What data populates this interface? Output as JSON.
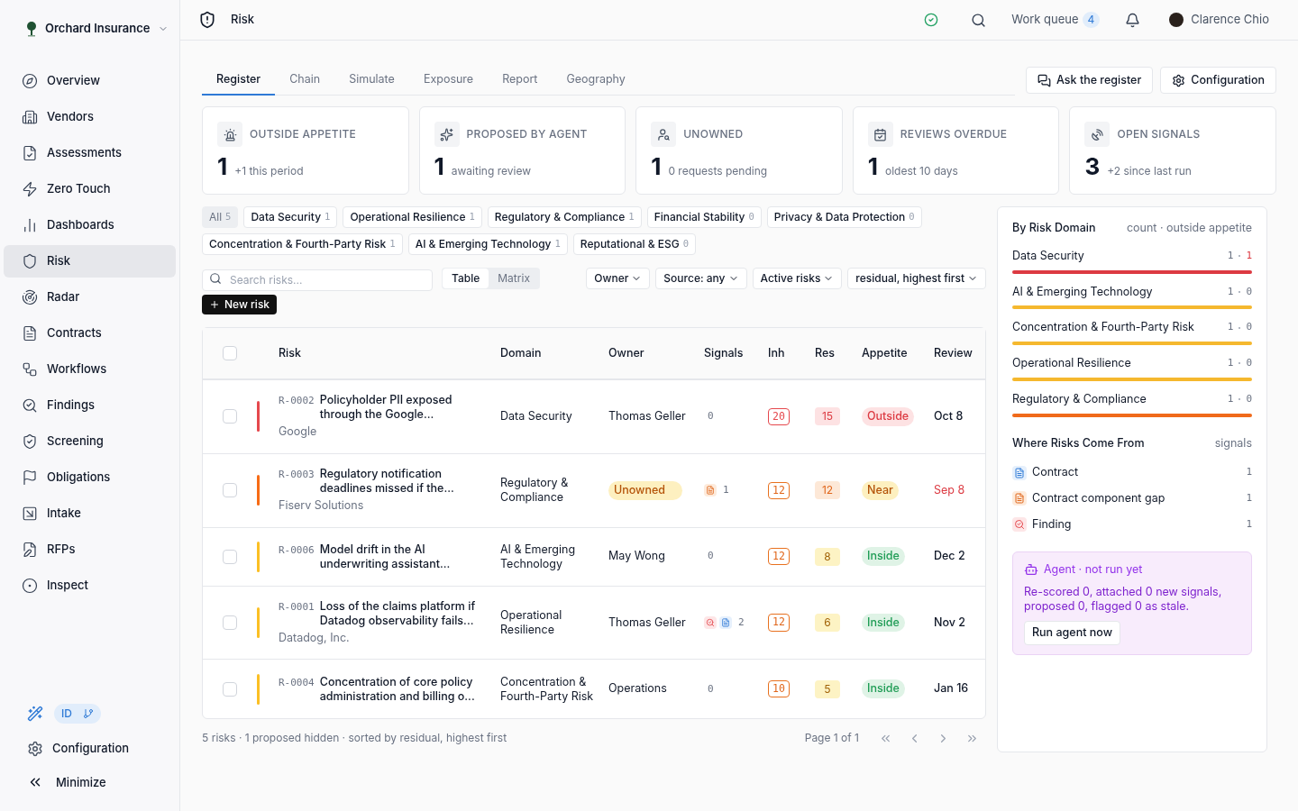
{
  "org": {
    "name": "Orchard Insurance"
  },
  "nav": [
    {
      "label": "Overview",
      "selected": false
    },
    {
      "label": "Vendors",
      "selected": false
    },
    {
      "label": "Assessments",
      "selected": false
    },
    {
      "label": "Zero Touch",
      "selected": false
    },
    {
      "label": "Dashboards",
      "selected": false
    },
    {
      "label": "Risk",
      "selected": true
    },
    {
      "label": "Radar",
      "selected": false
    },
    {
      "label": "Contracts",
      "selected": false
    },
    {
      "label": "Workflows",
      "selected": false
    },
    {
      "label": "Findings",
      "selected": false
    },
    {
      "label": "Screening",
      "selected": false
    },
    {
      "label": "Obligations",
      "selected": false
    },
    {
      "label": "Intake",
      "selected": false
    },
    {
      "label": "RFPs",
      "selected": false
    },
    {
      "label": "Inspect",
      "selected": false
    }
  ],
  "sidebar_footer": {
    "badge": "ID",
    "configuration": "Configuration",
    "minimize": "Minimize"
  },
  "header": {
    "title": "Risk",
    "work_queue": "Work queue",
    "work_queue_count": "4",
    "user": "Clarence Chio"
  },
  "tabs": [
    {
      "label": "Register",
      "selected": true
    },
    {
      "label": "Chain",
      "selected": false
    },
    {
      "label": "Simulate",
      "selected": false
    },
    {
      "label": "Exposure",
      "selected": false
    },
    {
      "label": "Report",
      "selected": false
    },
    {
      "label": "Geography",
      "selected": false
    }
  ],
  "actions": [
    "Ask the register",
    "Configuration"
  ],
  "stats": [
    {
      "title": "OUTSIDE APPETITE",
      "value": "1",
      "note": "+1 this period"
    },
    {
      "title": "PROPOSED BY AGENT",
      "value": "1",
      "note": "awaiting review"
    },
    {
      "title": "UNOWNED",
      "value": "1",
      "note": "0 requests pending"
    },
    {
      "title": "REVIEWS OVERDUE",
      "value": "1",
      "note": "oldest 10 days"
    },
    {
      "title": "OPEN SIGNALS",
      "value": "3",
      "note": "+2 since last run"
    }
  ],
  "domain_filters": [
    {
      "label": "All",
      "count": "5",
      "selected": true
    },
    {
      "label": "Data Security",
      "count": "1",
      "selected": false
    },
    {
      "label": "Operational Resilience",
      "count": "1",
      "selected": false
    },
    {
      "label": "Regulatory & Compliance",
      "count": "1",
      "selected": false
    },
    {
      "label": "Financial Stability",
      "count": "0",
      "selected": false
    },
    {
      "label": "Privacy & Data Protection",
      "count": "0",
      "selected": false
    },
    {
      "label": "Concentration & Fourth-Party Risk",
      "count": "1",
      "selected": false
    },
    {
      "label": "AI & Emerging Technology",
      "count": "1",
      "selected": false
    },
    {
      "label": "Reputational & ESG",
      "count": "0",
      "selected": false
    }
  ],
  "search": {
    "placeholder": "Search risks..."
  },
  "views": [
    {
      "label": "Table",
      "selected": true
    },
    {
      "label": "Matrix",
      "selected": false
    }
  ],
  "filters": [
    "Owner",
    "Source: any",
    "Active risks",
    "residual, highest first"
  ],
  "new_risk": "New risk",
  "table": {
    "all_checked": false,
    "columns": [
      "Risk",
      "Domain",
      "Owner",
      "Signals",
      "Inh",
      "Res",
      "Appetite",
      "Review"
    ],
    "rows": [
      {
        "checked": false,
        "color": "#e5484d",
        "id": "R-0002",
        "title": "Policyholder PII exposed through the Google...",
        "vendor": "Google",
        "domain": "Data Security",
        "owner": {
          "text": "Thomas Geller",
          "kind": "person"
        },
        "signals": [],
        "signal_count": "0",
        "inh": {
          "text": "20",
          "kind": "high"
        },
        "res": {
          "text": "15",
          "kind": "high"
        },
        "appetite": {
          "text": "Outside",
          "kind": "outside"
        },
        "review": "Oct 8",
        "review_overdue": false
      },
      {
        "checked": false,
        "color": "#f76b15",
        "id": "R-0003",
        "title": "Regulatory notification deadlines missed if the...",
        "vendor": "Fiserv Solutions",
        "domain": "Regulatory & Compliance",
        "owner": {
          "text": "Unowned",
          "kind": "unowned"
        },
        "signals": [
          {
            "kind": "gap"
          }
        ],
        "signal_count": "1",
        "inh": {
          "text": "12",
          "kind": "medium"
        },
        "res": {
          "text": "12",
          "kind": "medium"
        },
        "appetite": {
          "text": "Near",
          "kind": "near"
        },
        "review": "Sep 8",
        "review_overdue": true
      },
      {
        "checked": false,
        "color": "#fbbf24",
        "id": "R-0006",
        "title": "Model drift in the AI underwriting assistant...",
        "domain": "AI & Emerging Technology",
        "owner": {
          "text": "May Wong",
          "kind": "person"
        },
        "signals": [],
        "signal_count": "0",
        "inh": {
          "text": "12",
          "kind": "medium"
        },
        "res": {
          "text": "8",
          "kind": "low"
        },
        "appetite": {
          "text": "Inside",
          "kind": "inside"
        },
        "review": "Dec 2",
        "review_overdue": false
      },
      {
        "checked": false,
        "color": "#fbbf24",
        "id": "R-0001",
        "title": "Loss of the claims platform if Datadog observability fails...",
        "vendor": "Datadog, Inc.",
        "domain": "Operational Resilience",
        "owner": {
          "text": "Thomas Geller",
          "kind": "person"
        },
        "signals": [
          {
            "kind": "finding"
          },
          {
            "kind": "contract"
          }
        ],
        "signal_count": "2",
        "inh": {
          "text": "12",
          "kind": "medium"
        },
        "res": {
          "text": "6",
          "kind": "low"
        },
        "appetite": {
          "text": "Inside",
          "kind": "inside"
        },
        "review": "Nov 2",
        "review_overdue": false
      },
      {
        "checked": false,
        "color": "#fbbf24",
        "id": "R-0004",
        "title": "Concentration of core policy administration and billing o...",
        "domain": "Concentration & Fourth-Party Risk",
        "owner": {
          "text": "Operations",
          "kind": "person"
        },
        "signals": [],
        "signal_count": "0",
        "inh": {
          "text": "10",
          "kind": "medium"
        },
        "res": {
          "text": "5",
          "kind": "low"
        },
        "appetite": {
          "text": "Inside",
          "kind": "inside"
        },
        "review": "Jan 16",
        "review_overdue": false
      }
    ]
  },
  "footer": {
    "summary": "5 risks · 1 proposed hidden · sorted by residual, highest first",
    "page": "Page 1 of 1"
  },
  "by_domain": {
    "title": "By Risk Domain",
    "legend": "count · outside appetite",
    "items": [
      {
        "label": "Data Security",
        "count": "1",
        "outside": "1",
        "alert": true,
        "color": "#dc3a42"
      },
      {
        "label": "AI & Emerging Technology",
        "count": "1",
        "outside": "0",
        "alert": false,
        "color": "#f5b82e"
      },
      {
        "label": "Concentration & Fourth-Party Risk",
        "count": "1",
        "outside": "0",
        "alert": false,
        "color": "#f5b82e"
      },
      {
        "label": "Operational Resilience",
        "count": "1",
        "outside": "0",
        "alert": false,
        "color": "#f5b82e"
      },
      {
        "label": "Regulatory & Compliance",
        "count": "1",
        "outside": "0",
        "alert": false,
        "color": "#f06a1a"
      }
    ]
  },
  "sources": {
    "title": "Where Risks Come From",
    "legend": "signals",
    "items": [
      {
        "kind": "contract",
        "label": "Contract",
        "count": "1"
      },
      {
        "kind": "gap",
        "label": "Contract component gap",
        "count": "1"
      },
      {
        "kind": "finding",
        "label": "Finding",
        "count": "1"
      }
    ]
  },
  "agent": {
    "title": "Agent · not run yet",
    "text": "Re-scored 0, attached 0 new signals, proposed 0, flagged 0 as stale.",
    "button": "Run agent now"
  }
}
